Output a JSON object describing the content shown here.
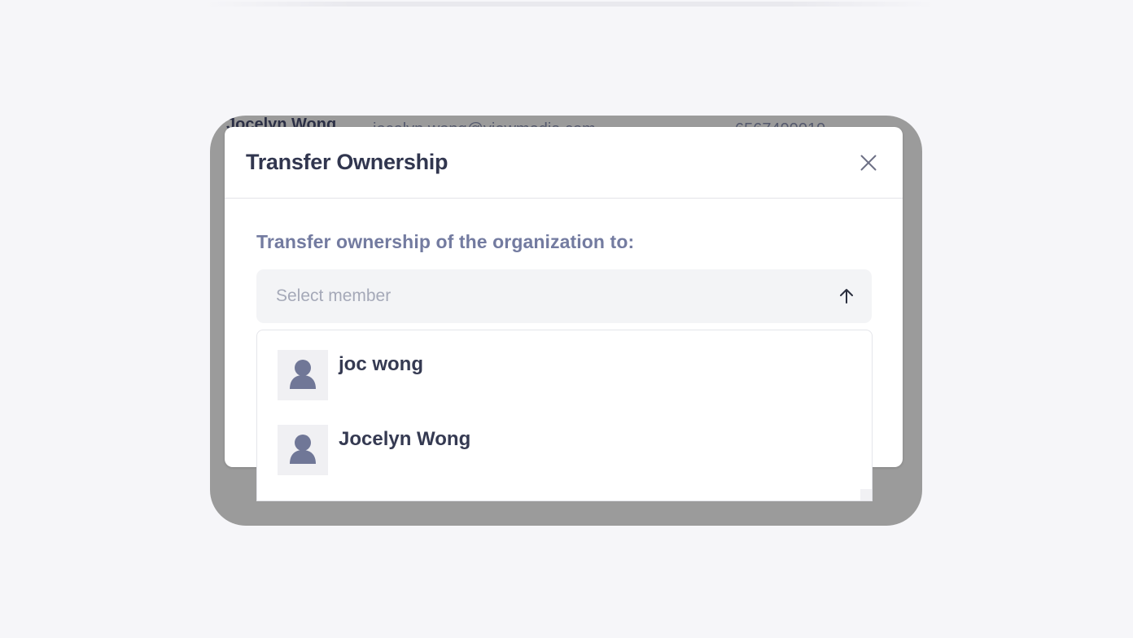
{
  "background_row": {
    "name": "Jocelyn Wong",
    "email": "jocelyn.wong@viewmedia.com",
    "phone": "6567499019"
  },
  "modal": {
    "title": "Transfer Ownership",
    "field_label": "Transfer ownership of the organization to:",
    "select": {
      "placeholder": "Select member"
    },
    "options": [
      {
        "name": "joc wong"
      },
      {
        "name": "Jocelyn Wong"
      }
    ]
  },
  "colors": {
    "overlay": "#9b9b9b",
    "title": "#31364f",
    "label": "#737ba0",
    "avatar_icon": "#707797"
  }
}
